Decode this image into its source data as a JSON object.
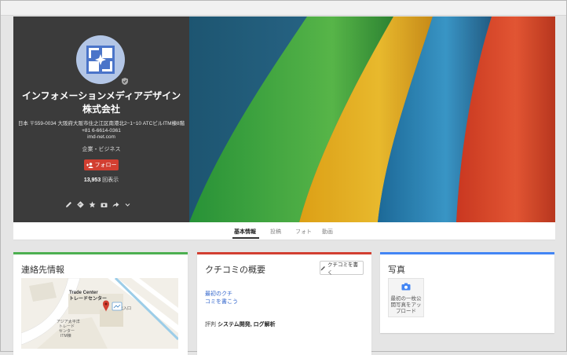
{
  "profile": {
    "name": "インフォメーションメディアデザイン株式会社",
    "address": "日本 〒559-0034 大阪府大阪市住之江区南港北2−1−10 ATCビルITM棟8階",
    "phone": "+81 6-6614-0361",
    "website": "imd-net.com",
    "category": "企業・ビジネス",
    "follow_label": "フォロー",
    "views_count": "13,953",
    "views_suffix": " 回表示",
    "action_icons": [
      "pencil-icon",
      "directions-icon",
      "star-icon",
      "camera-icon",
      "share-icon",
      "chevron-down-icon"
    ]
  },
  "tabs": [
    {
      "label": "基本情報",
      "active": true
    },
    {
      "label": "投稿",
      "active": false
    },
    {
      "label": "フォト",
      "active": false
    },
    {
      "label": "動画",
      "active": false
    }
  ],
  "contact": {
    "title": "連絡先情報",
    "map_label_1": "Trade Center",
    "map_label_2": "トレードセンター",
    "map_label_3": "アジア太平洋",
    "map_label_4": "トレード",
    "map_label_5": "センター",
    "map_label_6": "ITM棟",
    "map_label_7": "北入口",
    "accent_color": "#4caf50"
  },
  "reviews": {
    "title": "クチコミの概要",
    "write_button": "クチコミを書く",
    "link_line1": "最初のクチ",
    "link_line2": "コミを書こう",
    "tags_label": "評判",
    "tags": "システム開発, ログ解析",
    "accent_color": "#d23f31"
  },
  "photos": {
    "title": "写真",
    "tile_line1": "最初の一枚公",
    "tile_line2": "開写真をアッ",
    "tile_line3": "プロード",
    "accent_color": "#4285f4"
  }
}
